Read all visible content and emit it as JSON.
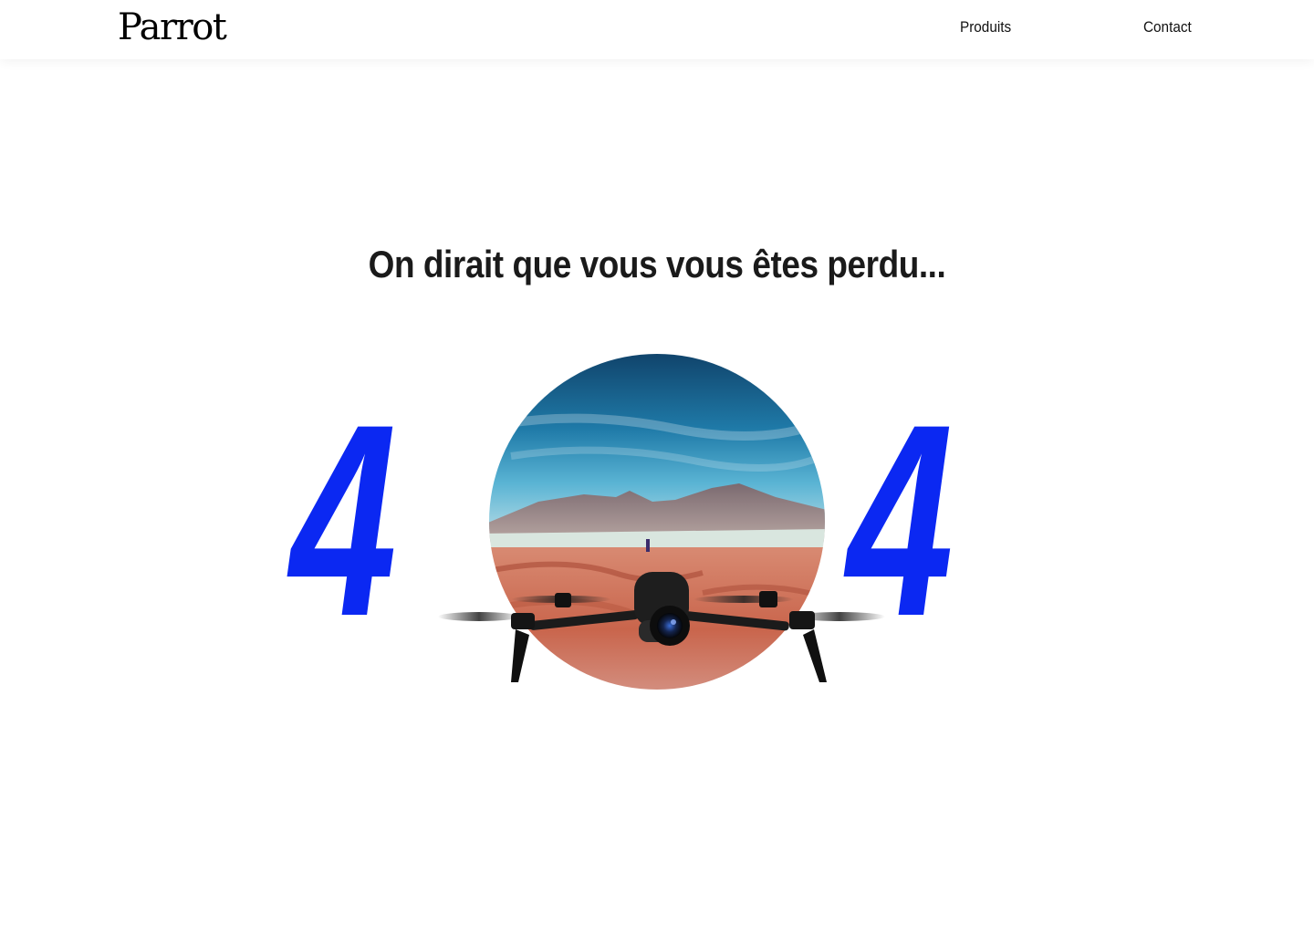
{
  "header": {
    "logo_text": "Parrot",
    "nav": [
      {
        "label": "Produits"
      },
      {
        "label": "Contact"
      }
    ]
  },
  "main": {
    "headline": "On dirait que vous vous êtes perdu...",
    "error_code": {
      "left_digit": "4",
      "right_digit": "4"
    },
    "illustration_icon": "drone-over-landscape"
  },
  "colors": {
    "accent": "#0b28f2",
    "text": "#1a1a1a",
    "background": "#ffffff"
  }
}
